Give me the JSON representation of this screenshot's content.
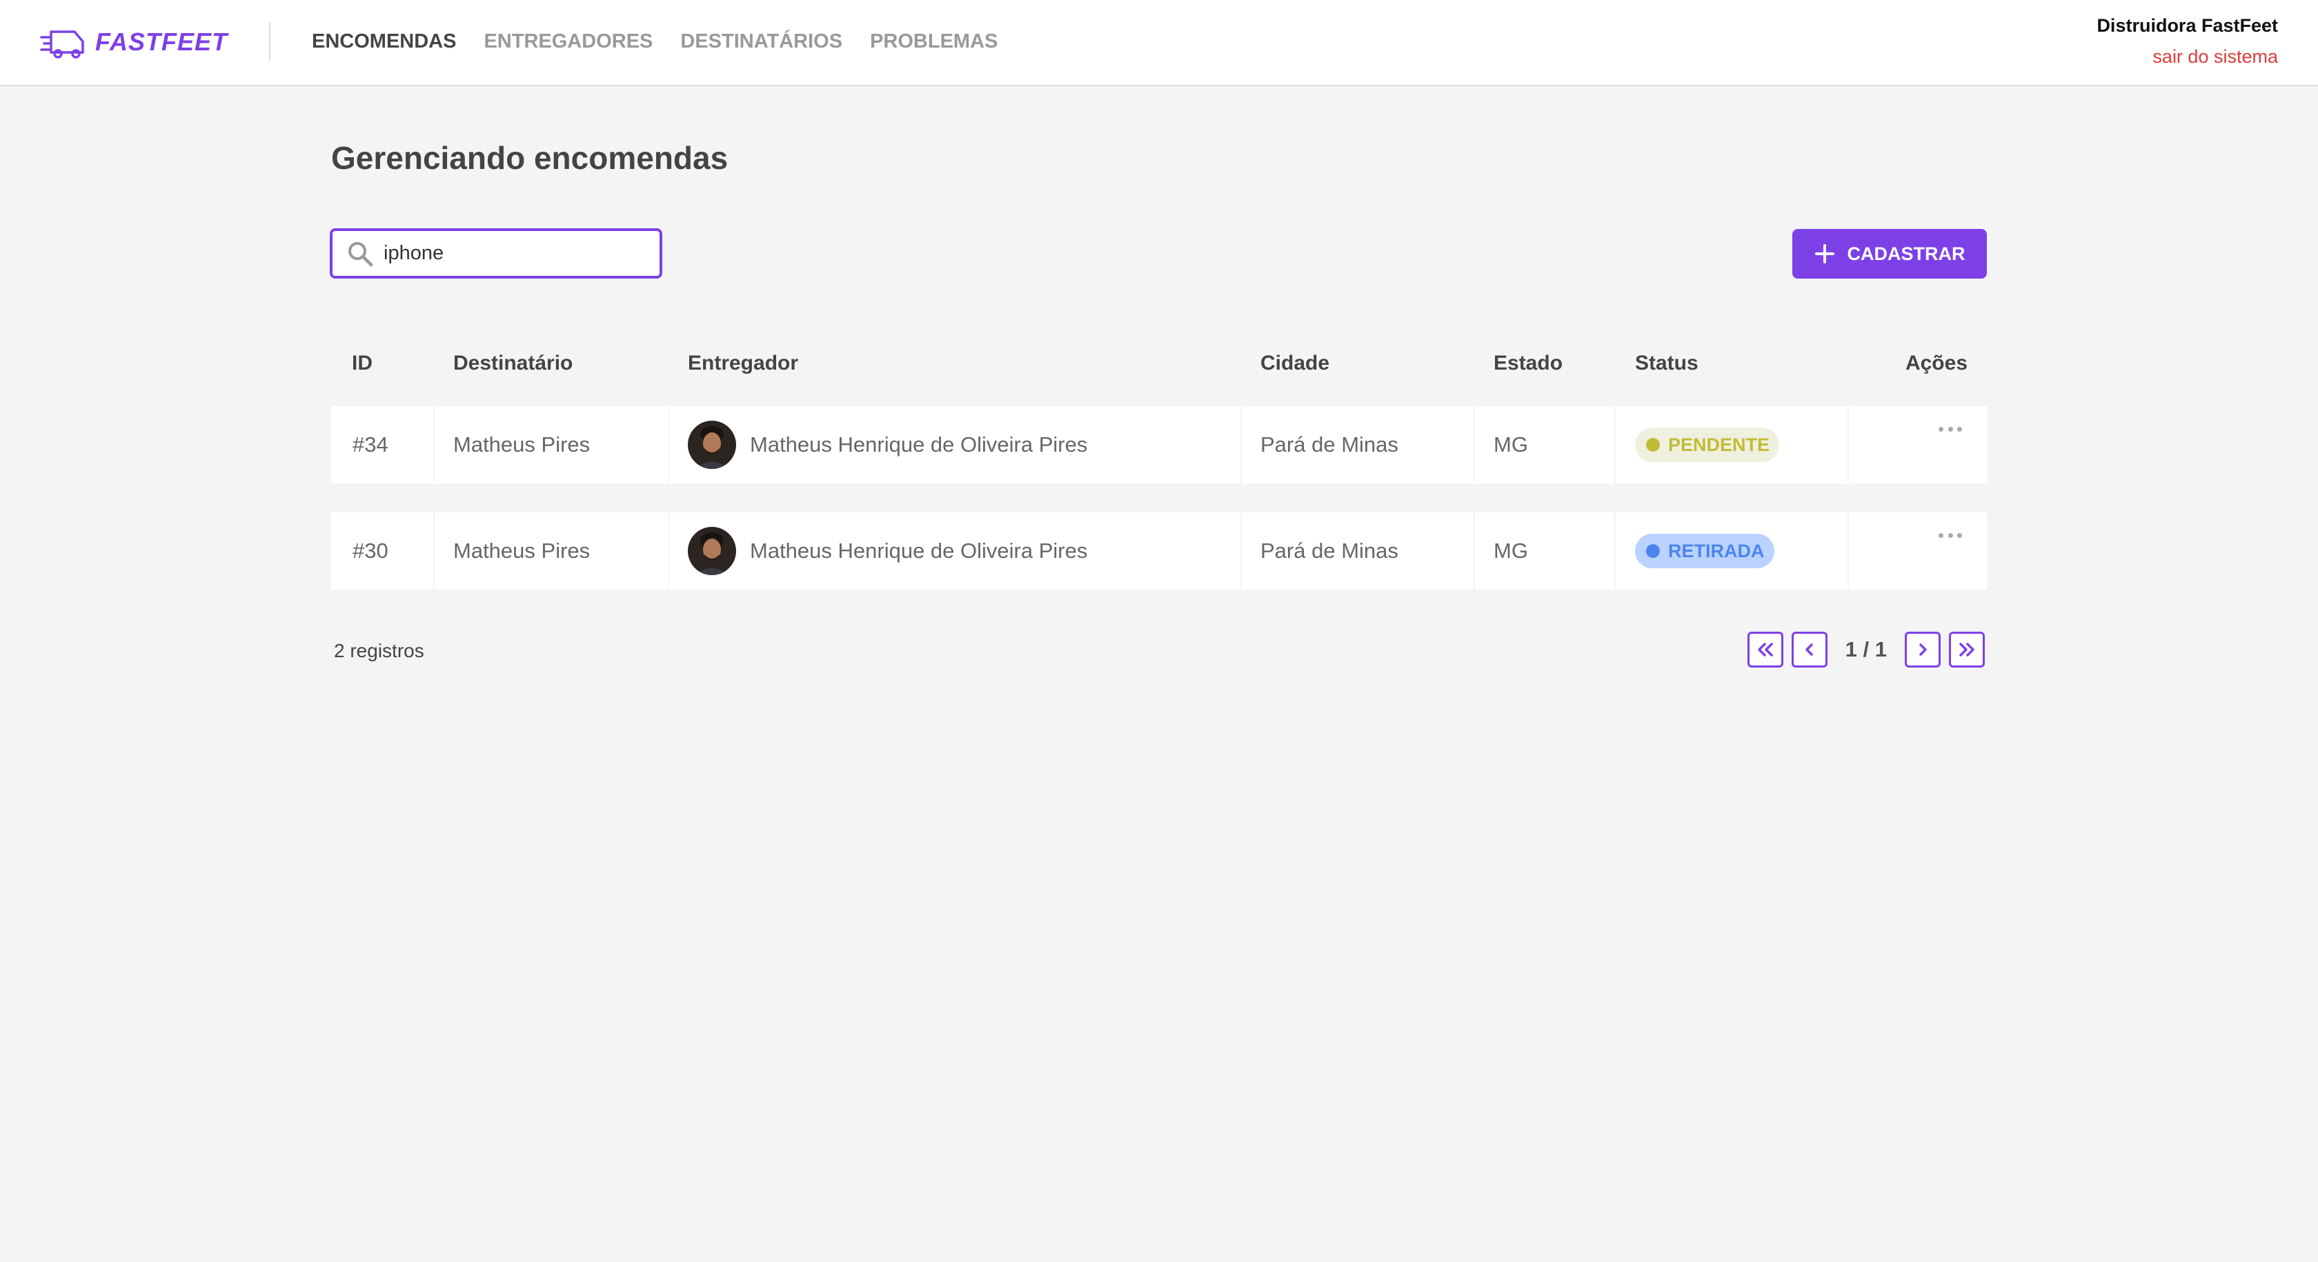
{
  "brand": {
    "name": "FASTFEET",
    "accent_color": "#7d40e7"
  },
  "nav": {
    "items": [
      {
        "label": "ENCOMENDAS",
        "active": true
      },
      {
        "label": "ENTREGADORES",
        "active": false
      },
      {
        "label": "DESTINATÁRIOS",
        "active": false
      },
      {
        "label": "PROBLEMAS",
        "active": false
      }
    ]
  },
  "user": {
    "name": "Distruidora FastFeet",
    "logout_label": "sair do sistema"
  },
  "page": {
    "title": "Gerenciando encomendas"
  },
  "search": {
    "value": "iphone",
    "icon": "search-icon"
  },
  "add_button": {
    "label": "CADASTRAR",
    "icon": "plus-icon"
  },
  "table": {
    "headers": [
      "ID",
      "Destinatário",
      "Entregador",
      "Cidade",
      "Estado",
      "Status",
      "Ações"
    ],
    "rows": [
      {
        "id": "#34",
        "recipient": "Matheus Pires",
        "deliveryman": "Matheus Henrique de Oliveira Pires",
        "city": "Pará de Minas",
        "state": "MG",
        "status": "PENDENTE",
        "status_color": "#c1bc35",
        "status_bg": "#f0f0df"
      },
      {
        "id": "#30",
        "recipient": "Matheus Pires",
        "deliveryman": "Matheus Henrique de Oliveira Pires",
        "city": "Pará de Minas",
        "state": "MG",
        "status": "RETIRADA",
        "status_color": "#4d85ee",
        "status_bg": "#bad2ff"
      }
    ]
  },
  "footer": {
    "records": "2 registros",
    "page_indicator": "1 / 1"
  }
}
